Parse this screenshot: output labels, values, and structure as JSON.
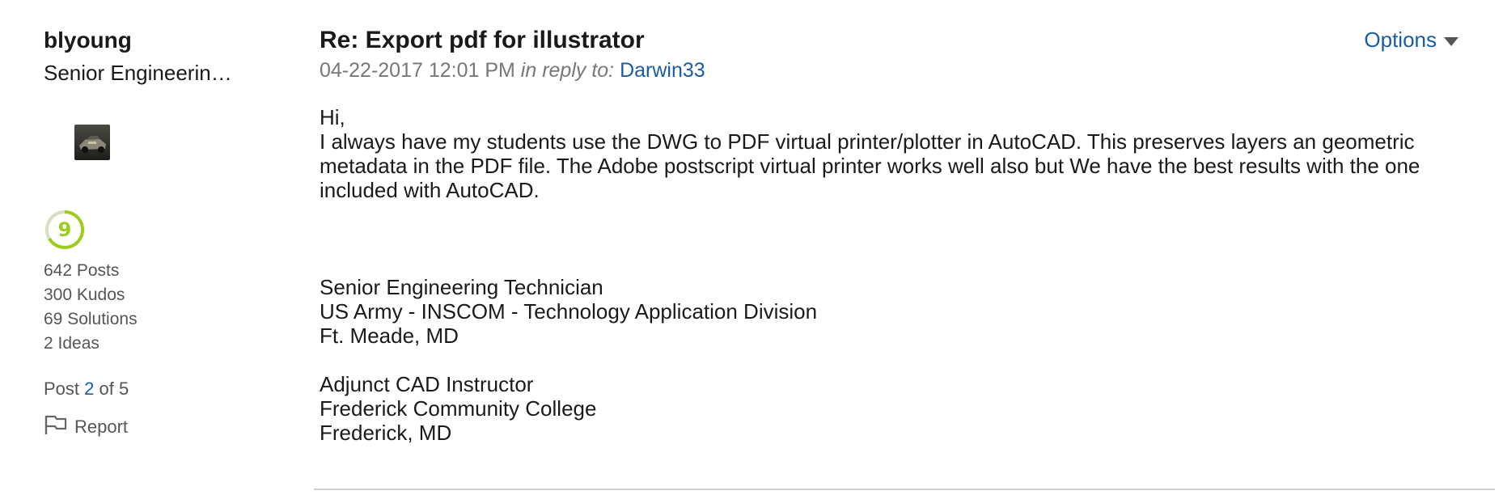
{
  "author": {
    "username": "blyoung",
    "rank": "Senior Engineerin…",
    "level": "9",
    "stats": [
      {
        "label": "642 Posts"
      },
      {
        "label": "300 Kudos"
      },
      {
        "label": "69 Solutions"
      },
      {
        "label": "2 Ideas"
      }
    ],
    "post_position": {
      "prefix": "Post",
      "number": "2",
      "suffix": "of 5"
    },
    "report_label": "Report"
  },
  "message": {
    "subject": "Re: Export pdf for illustrator",
    "timestamp": "04-22-2017 12:01 PM",
    "in_reply_label": "in reply to:",
    "reply_user": "Darwin33",
    "body": {
      "greeting": "Hi,",
      "paragraph": "I always have my students use the DWG to PDF virtual printer/plotter in AutoCAD.  This preserves layers an geometric metadata in the PDF file.  The Adobe postscript virtual printer works well also but We have the best results with the one included with AutoCAD.",
      "signature_1": [
        "Senior Engineering Technician",
        "US Army - INSCOM - Technology Application Division",
        "Ft. Meade, MD"
      ],
      "signature_2": [
        "Adjunct CAD Instructor",
        "Frederick Community College",
        "Frederick, MD"
      ]
    },
    "options_label": "Options"
  },
  "colors": {
    "link": "#1a5ba6",
    "muted": "#777777",
    "badge_green": "#9ccc1c"
  },
  "icons": {
    "options": "chevron-down-icon",
    "report": "flag-icon",
    "level": "level-badge-icon"
  }
}
